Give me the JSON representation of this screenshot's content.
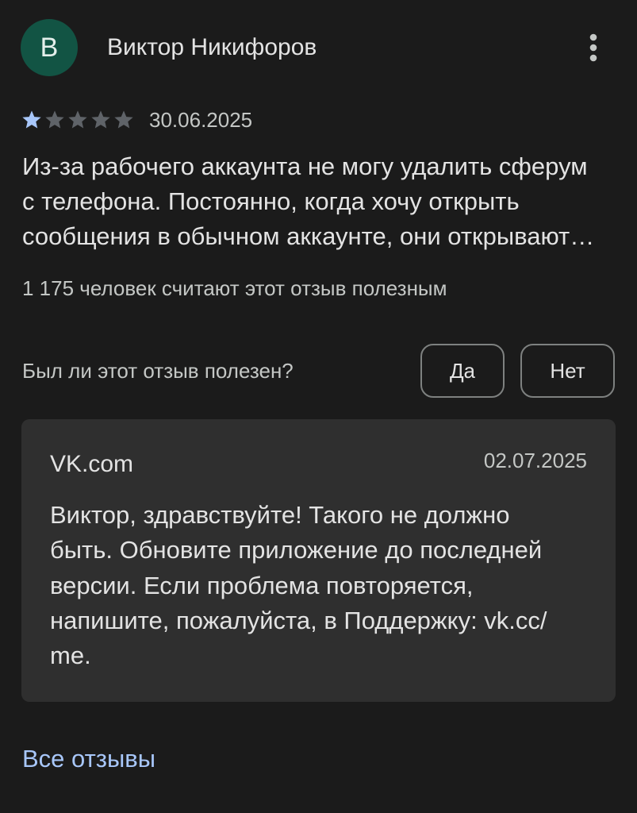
{
  "review": {
    "author_initial": "В",
    "author_name": "Виктор Никифоров",
    "rating": 1,
    "rating_max": 5,
    "date": "30.06.2025",
    "text": "Из-за рабочего аккаунта не могу удалить сферум\nс телефона. Постоянно, когда хочу открыть\nсообщения в обычном аккаунте, они открывают…",
    "helpful_count_text": "1 175 человек считают этот отзыв полезным"
  },
  "feedback": {
    "question": "Был ли этот отзыв полезен?",
    "yes_label": "Да",
    "no_label": "Нет"
  },
  "developer_reply": {
    "author": "VK.com",
    "date": "02.07.2025",
    "text": "Виктор, здравствуйте! Такого не должно\nбыть. Обновите приложение до последней\nверсии. Если проблема повторяется,\nнапишите, пожалуйста, в Поддержку: vk.cc/\nme."
  },
  "footer": {
    "all_reviews_label": "Все отзывы"
  },
  "icons": {
    "menu": "more-vert-icon",
    "rating": "star-icon"
  },
  "colors": {
    "background": "#1b1b1b",
    "text_primary": "#e3e3e3",
    "text_secondary": "#c4c7c5",
    "avatar": "#125444",
    "star_filled": "#a8c7fa",
    "star_empty": "#5f6368",
    "link": "#a8c7fa",
    "reply_background": "#2f2f2f",
    "button_border": "#7e8180"
  }
}
